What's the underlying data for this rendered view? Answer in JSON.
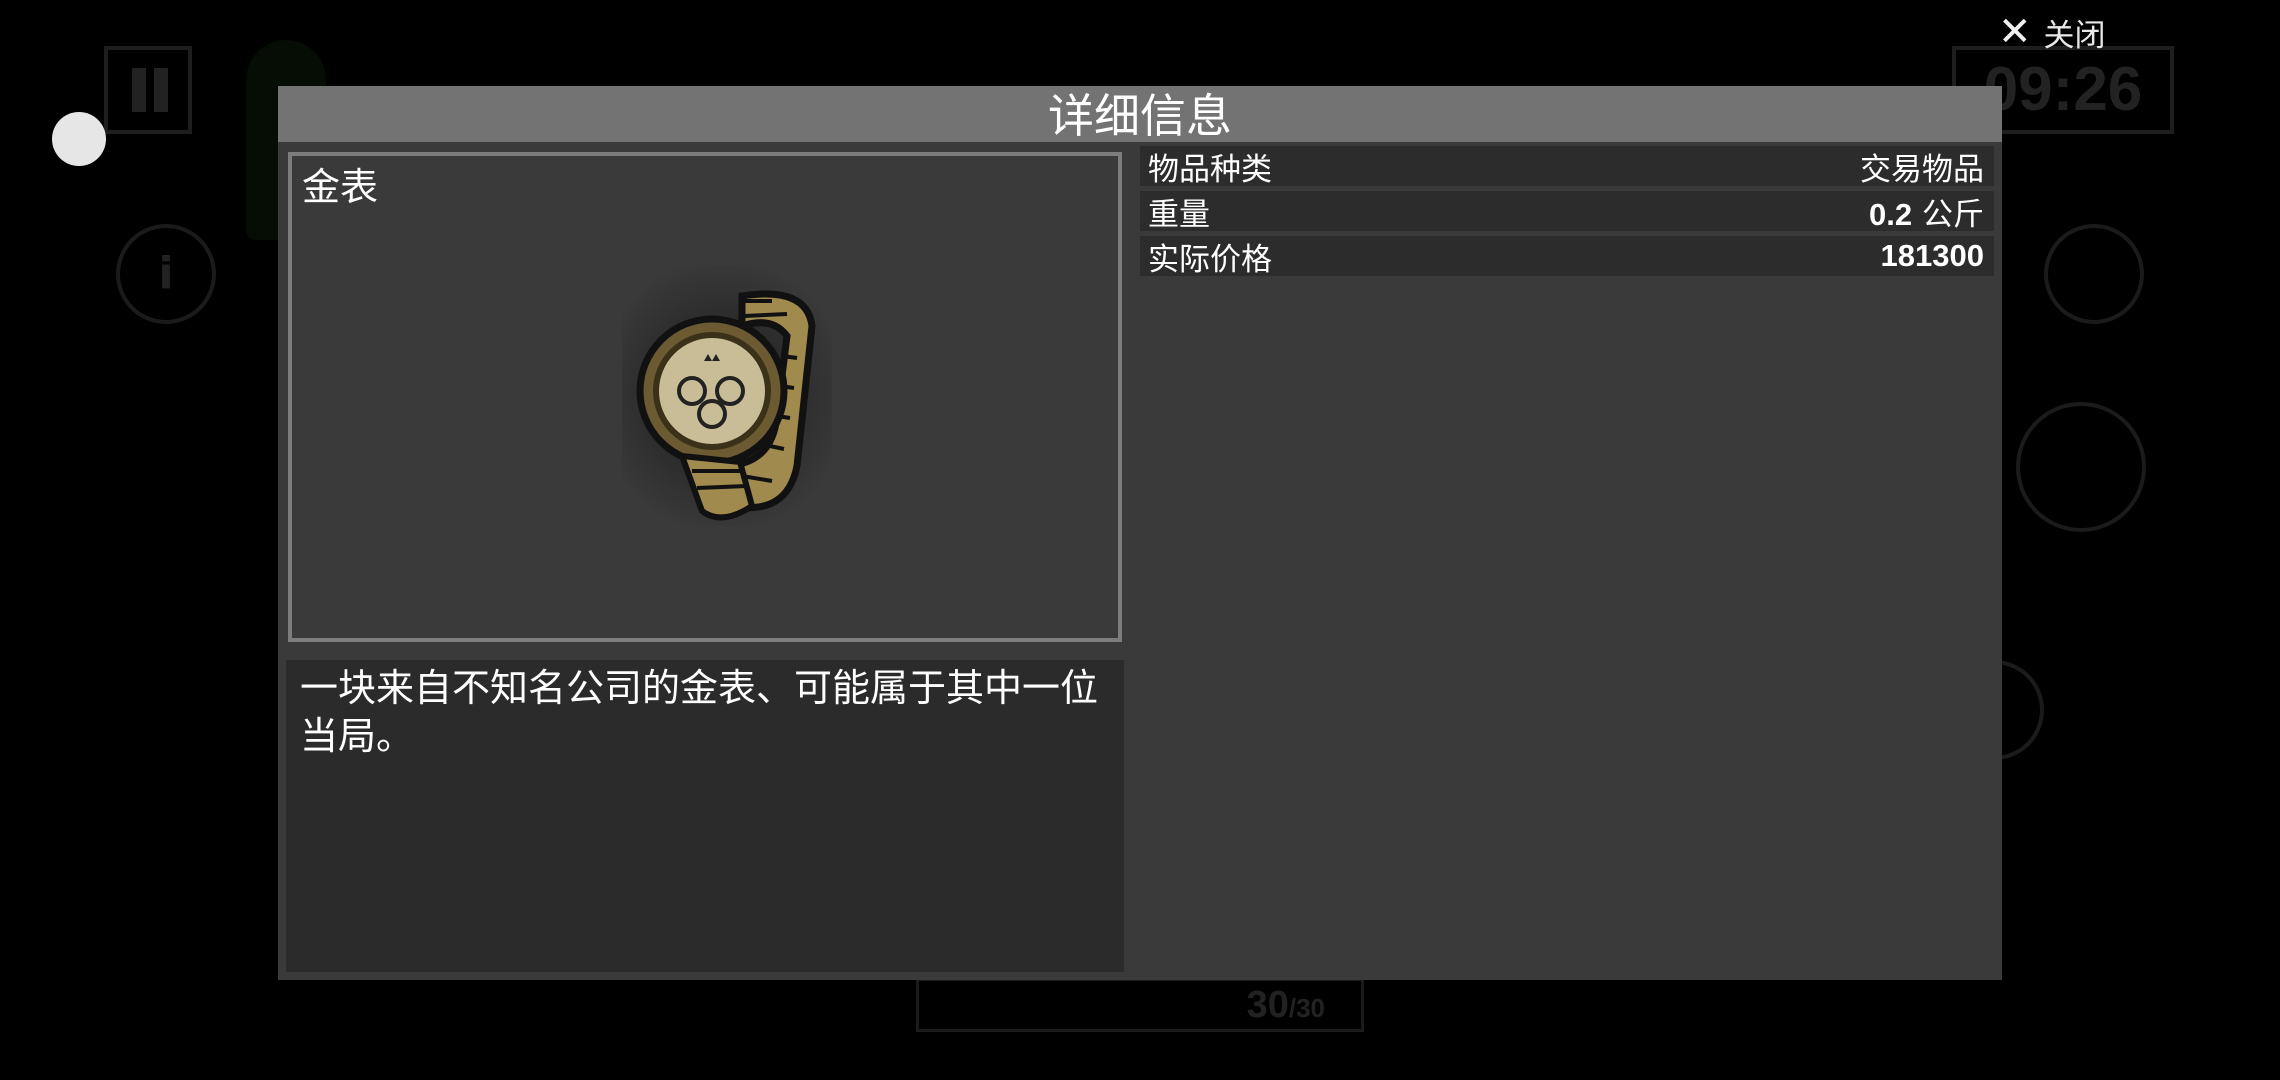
{
  "hud": {
    "clock": "09:26",
    "ammo_current": "30",
    "ammo_separator": "/",
    "ammo_max": "30",
    "info_icon_glyph": "i"
  },
  "close_label": "关闭",
  "dialog": {
    "title": "详细信息",
    "item_name": "金表",
    "item_icon": "gold-watch",
    "description": "一块来自不知名公司的金表、可能属于其中一位当局。",
    "stats": [
      {
        "label": "物品种类",
        "value": "交易物品"
      },
      {
        "label": "重量",
        "value_number": "0.2",
        "value_unit": "公斤"
      },
      {
        "label": "实际价格",
        "value_number": "181300"
      }
    ]
  }
}
